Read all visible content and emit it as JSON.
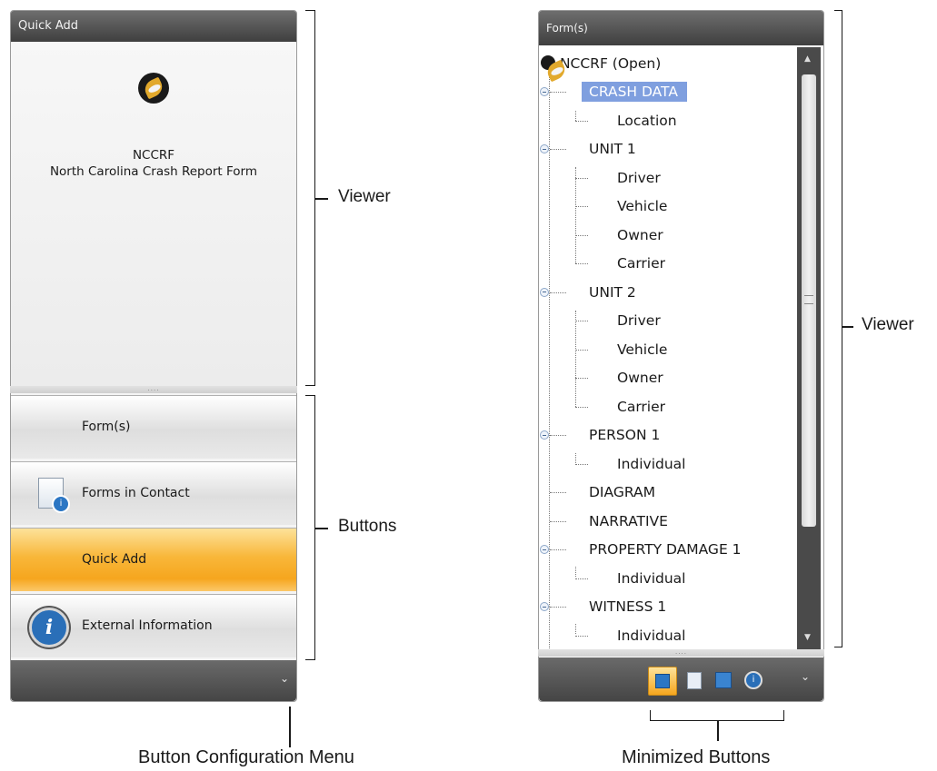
{
  "left_panel": {
    "header_title": "Quick Add",
    "viewer_title_line1": "NCCRF",
    "viewer_title_line2": "North Carolina Crash Report Form",
    "buttons": [
      {
        "label": "Form(s)",
        "icon": "none",
        "active": false
      },
      {
        "label": "Forms in Contact",
        "icon": "document-info-icon",
        "active": false
      },
      {
        "label": "Quick Add",
        "icon": "none",
        "active": true
      },
      {
        "label": "External Information",
        "icon": "info-icon",
        "active": false
      }
    ],
    "footer_icon": "chevron-down-icon"
  },
  "right_panel": {
    "header_title": "Form(s)",
    "root": "NCCRF (Open)",
    "tree": [
      {
        "label": "CRASH DATA",
        "level": 1,
        "selected": true
      },
      {
        "label": "Location",
        "level": 2
      },
      {
        "label": "UNIT 1",
        "level": 1
      },
      {
        "label": "Driver",
        "level": 2
      },
      {
        "label": "Vehicle",
        "level": 2
      },
      {
        "label": "Owner",
        "level": 2
      },
      {
        "label": "Carrier",
        "level": 2
      },
      {
        "label": "UNIT 2",
        "level": 1
      },
      {
        "label": "Driver",
        "level": 2
      },
      {
        "label": "Vehicle",
        "level": 2
      },
      {
        "label": "Owner",
        "level": 2
      },
      {
        "label": "Carrier",
        "level": 2
      },
      {
        "label": "PERSON 1",
        "level": 1
      },
      {
        "label": "Individual",
        "level": 2
      },
      {
        "label": "DIAGRAM",
        "level": 1
      },
      {
        "label": "NARRATIVE",
        "level": 1
      },
      {
        "label": "PROPERTY DAMAGE 1",
        "level": 1
      },
      {
        "label": "Individual",
        "level": 2
      },
      {
        "label": "WITNESS 1",
        "level": 1
      },
      {
        "label": "Individual",
        "level": 2
      }
    ],
    "mini_buttons": [
      "forms-stack-icon",
      "document-info-icon",
      "quick-add-icon",
      "info-icon"
    ]
  },
  "annotations": {
    "left_viewer": "Viewer",
    "left_buttons": "Buttons",
    "config_menu": "Button Configuration Menu",
    "right_viewer": "Viewer",
    "minimized": "Minimized Buttons"
  },
  "colors": {
    "active_button": "#f6a61e",
    "selection": "#7f9fdf",
    "header": "#4a4a4a"
  }
}
